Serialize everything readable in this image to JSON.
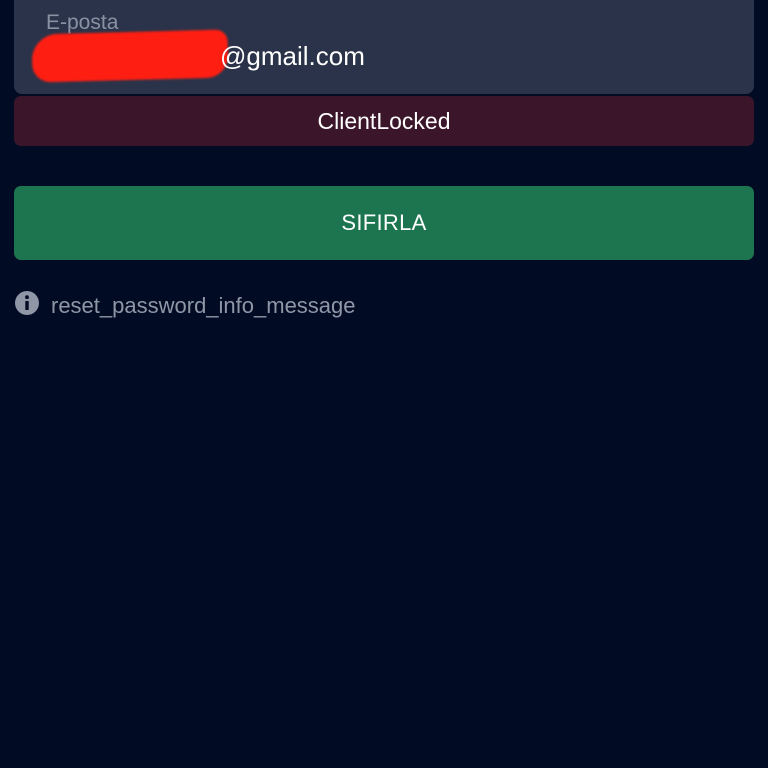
{
  "email_field": {
    "label": "E-posta",
    "value": "@gmail.com"
  },
  "error_banner": {
    "text": "ClientLocked"
  },
  "reset_button": {
    "label": "SIFIRLA"
  },
  "info": {
    "icon": "info-icon",
    "message": "reset_password_info_message"
  },
  "colors": {
    "background": "#020b24",
    "field_background": "#2a3349",
    "error_background": "#3b1529",
    "button_background": "#1d7550",
    "redaction": "#ff1e12"
  }
}
